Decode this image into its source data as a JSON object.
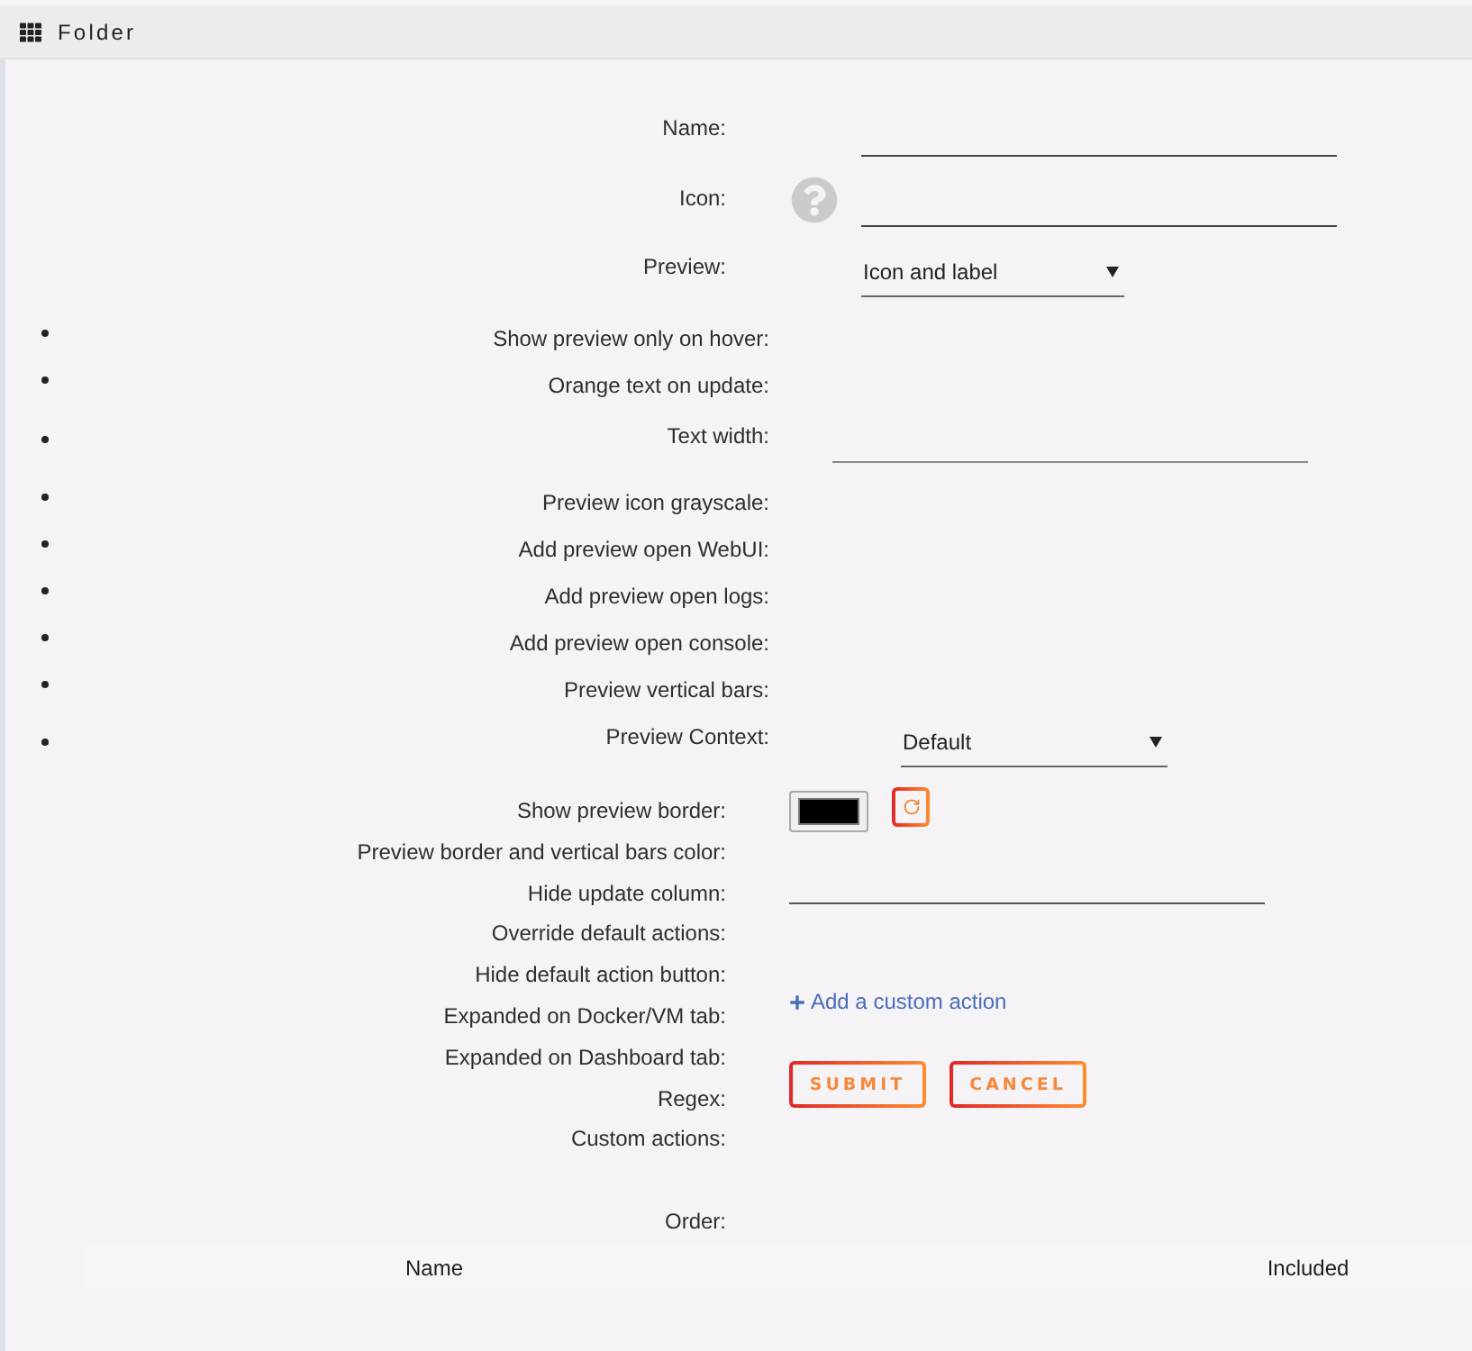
{
  "window": {
    "title": "Folder"
  },
  "fields": [
    {
      "label": "Name:",
      "kind": "text"
    },
    {
      "label": "Icon:",
      "kind": "icon"
    },
    {
      "label": "Preview:",
      "kind": "select",
      "value": "Icon and label"
    }
  ],
  "preview_settings": [
    {
      "label": "Show preview only on hover:",
      "kind": "plain"
    },
    {
      "label": "Orange text on update:",
      "kind": "plain"
    },
    {
      "label": "Text width:",
      "kind": "text"
    },
    {
      "label": "Preview icon grayscale:",
      "kind": "plain"
    },
    {
      "label": "Add preview open WebUI:",
      "kind": "plain"
    },
    {
      "label": "Add preview open logs:",
      "kind": "plain"
    },
    {
      "label": "Add preview open console:",
      "kind": "plain"
    },
    {
      "label": "Preview vertical bars:",
      "kind": "plain"
    },
    {
      "label": "Preview Context:",
      "kind": "select",
      "value": "Default"
    }
  ],
  "other_settings": {
    "labels": [
      "Show preview border:",
      "Preview border and vertical bars color:",
      "Hide update column:",
      "Override default actions:",
      "Hide default action button:",
      "Expanded on Docker/VM tab:",
      "Expanded on Dashboard tab:",
      "Regex:",
      "Custom actions:"
    ],
    "color_picker": {
      "color": "#000000"
    },
    "custom_action_link": "Add a custom action",
    "buttons": [
      "SUBMIT",
      "CANCEL"
    ]
  },
  "order": {
    "label": "Order:",
    "table": {
      "columns": [
        "Name",
        "Included"
      ]
    }
  }
}
